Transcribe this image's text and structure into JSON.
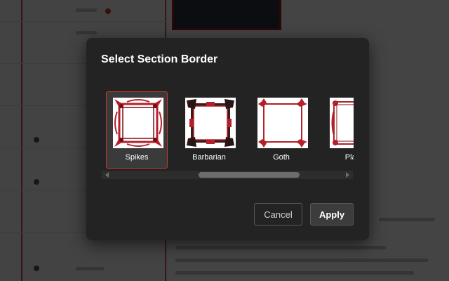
{
  "dialog": {
    "title": "Select Section Border",
    "borders": [
      {
        "label": "Spikes",
        "selected": true,
        "icon": "spikes-border-icon"
      },
      {
        "label": "Barbarian",
        "selected": false,
        "icon": "barbarian-border-icon"
      },
      {
        "label": "Goth",
        "selected": false,
        "icon": "goth-border-icon"
      },
      {
        "label": "Plain",
        "selected": false,
        "icon": "plain-border-icon"
      }
    ],
    "cancel_label": "Cancel",
    "apply_label": "Apply"
  },
  "colors": {
    "accent": "#c0392b",
    "border_red": "#b3202a",
    "dialog_bg": "#232323"
  }
}
